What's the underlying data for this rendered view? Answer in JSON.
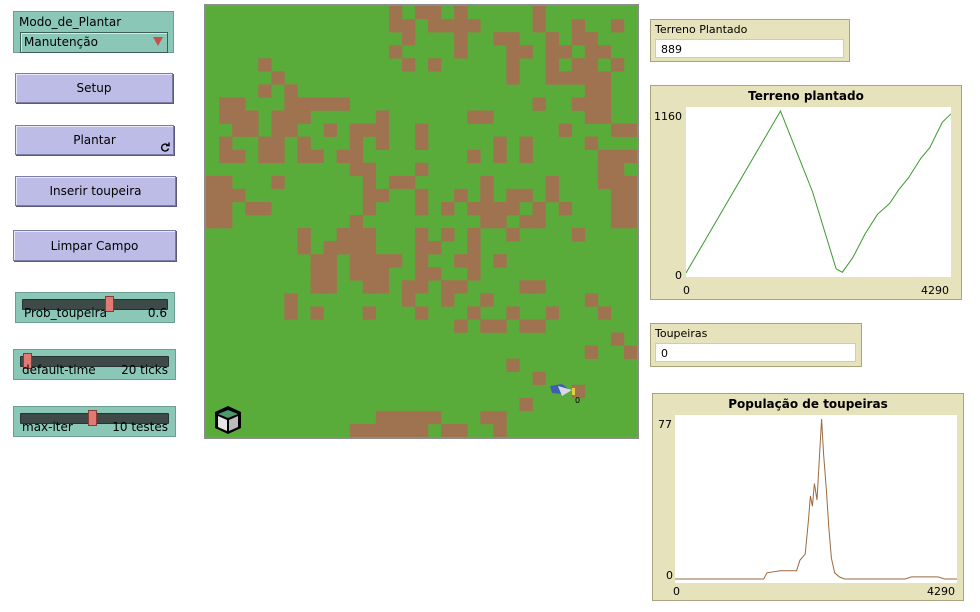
{
  "chooser": {
    "label": "Modo_de_Plantar",
    "value": "Manutenção"
  },
  "buttons": {
    "setup": "Setup",
    "plantar": "Plantar",
    "inserir": "Inserir toupeira",
    "limpar": "Limpar Campo"
  },
  "sliders": [
    {
      "label": "Prob_toupeira",
      "value": "0.6",
      "fraction": 0.6
    },
    {
      "label": "default-time",
      "value": "20 ticks",
      "fraction": 0.02
    },
    {
      "label": "max-iter",
      "value": "10 testes",
      "fraction": 0.48
    }
  ],
  "world": {
    "colors": {
      "grass": "#59ac3a",
      "dirt": "#a07350"
    },
    "turtle_label": "0"
  },
  "monitors": {
    "terreno": {
      "label": "Terreno Plantado",
      "value": "889"
    },
    "toupeiras": {
      "label": "Toupeiras",
      "value": "0"
    }
  },
  "chart_data": [
    {
      "type": "line",
      "title": "Terreno plantado",
      "xlabel": "",
      "ylabel": "",
      "xlim": [
        0,
        4290
      ],
      "ylim": [
        0,
        1160
      ],
      "x_ticks": [
        "0",
        "4290"
      ],
      "y_ticks": [
        "0",
        "1160"
      ],
      "color": "#3a9a2e",
      "series": [
        {
          "points": [
            [
              0,
              0
            ],
            [
              1530,
              1160
            ],
            [
              2050,
              580
            ],
            [
              2430,
              30
            ],
            [
              2530,
              5
            ],
            [
              2700,
              110
            ],
            [
              2900,
              280
            ],
            [
              3100,
              420
            ],
            [
              3300,
              500
            ],
            [
              3450,
              600
            ],
            [
              3600,
              680
            ],
            [
              3800,
              820
            ],
            [
              3950,
              900
            ],
            [
              4060,
              1000
            ],
            [
              4150,
              1080
            ],
            [
              4290,
              1140
            ]
          ]
        }
      ]
    },
    {
      "type": "line",
      "title": "População de toupeiras",
      "xlabel": "",
      "ylabel": "",
      "xlim": [
        0,
        4290
      ],
      "ylim": [
        0,
        77
      ],
      "x_ticks": [
        "0",
        "4290"
      ],
      "y_ticks": [
        "0",
        "77"
      ],
      "color": "#9c6a3e",
      "series": [
        {
          "points": [
            [
              0,
              0
            ],
            [
              1350,
              0
            ],
            [
              1400,
              3
            ],
            [
              1600,
              4
            ],
            [
              1850,
              4
            ],
            [
              1900,
              9
            ],
            [
              1980,
              12
            ],
            [
              2030,
              28
            ],
            [
              2060,
              40
            ],
            [
              2090,
              35
            ],
            [
              2120,
              46
            ],
            [
              2160,
              38
            ],
            [
              2190,
              55
            ],
            [
              2230,
              77
            ],
            [
              2260,
              60
            ],
            [
              2300,
              44
            ],
            [
              2340,
              25
            ],
            [
              2380,
              10
            ],
            [
              2430,
              3
            ],
            [
              2500,
              1
            ],
            [
              2580,
              0
            ],
            [
              3500,
              0
            ],
            [
              3600,
              1
            ],
            [
              4000,
              1
            ],
            [
              4100,
              0
            ],
            [
              4290,
              0
            ]
          ]
        }
      ]
    }
  ]
}
